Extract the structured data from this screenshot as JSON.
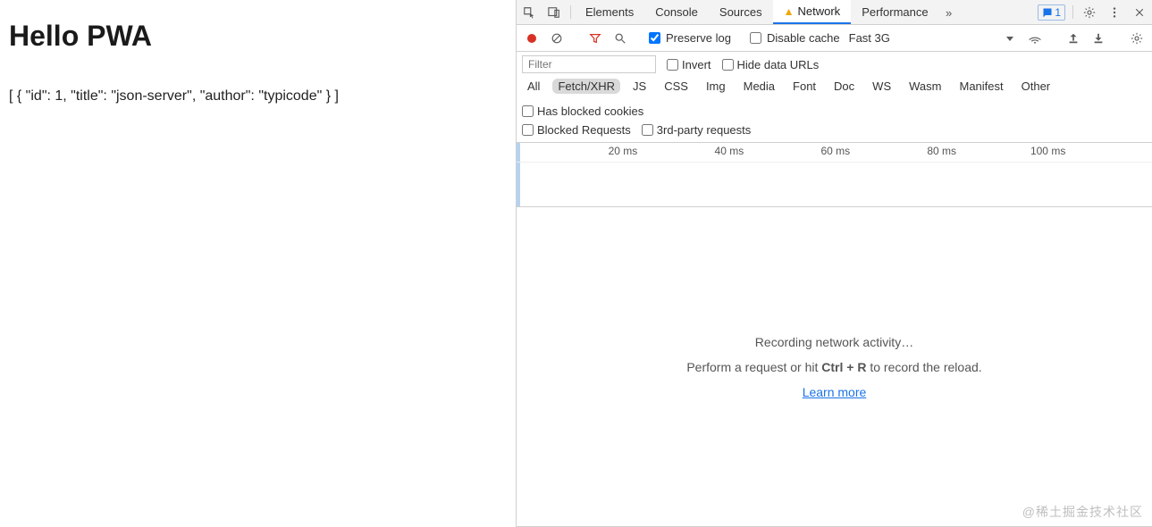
{
  "page": {
    "heading": "Hello PWA",
    "json_line": "[ { \"id\": 1, \"title\": \"json-server\", \"author\": \"typicode\" } ]"
  },
  "devtools": {
    "tabs": [
      "Elements",
      "Console",
      "Sources",
      "Network",
      "Performance"
    ],
    "active_tab_index": 3,
    "network_has_warning": true,
    "more_chevrons": "»",
    "issues_badge": "1",
    "toolbar": {
      "preserve_log": {
        "label": "Preserve log",
        "checked": true
      },
      "disable_cache": {
        "label": "Disable cache",
        "checked": false
      },
      "throttle": "Fast 3G"
    },
    "filterbar": {
      "filter_placeholder": "Filter",
      "invert": {
        "label": "Invert",
        "checked": false
      },
      "hide_data_urls": {
        "label": "Hide data URLs",
        "checked": false
      },
      "types": [
        "All",
        "Fetch/XHR",
        "JS",
        "CSS",
        "Img",
        "Media",
        "Font",
        "Doc",
        "WS",
        "Wasm",
        "Manifest",
        "Other"
      ],
      "active_type_index": 1,
      "has_blocked_cookies": {
        "label": "Has blocked cookies",
        "checked": false
      },
      "blocked_requests": {
        "label": "Blocked Requests",
        "checked": false
      },
      "third_party": {
        "label": "3rd-party requests",
        "checked": false
      }
    },
    "ruler": {
      "ticks": [
        "20 ms",
        "40 ms",
        "60 ms",
        "80 ms",
        "100 ms"
      ]
    },
    "body": {
      "headline": "Recording network activity…",
      "hint_prefix": "Perform a request or hit ",
      "hint_key": "Ctrl + R",
      "hint_suffix": " to record the reload.",
      "learn_more": "Learn more"
    },
    "watermark": "@稀土掘金技术社区"
  }
}
